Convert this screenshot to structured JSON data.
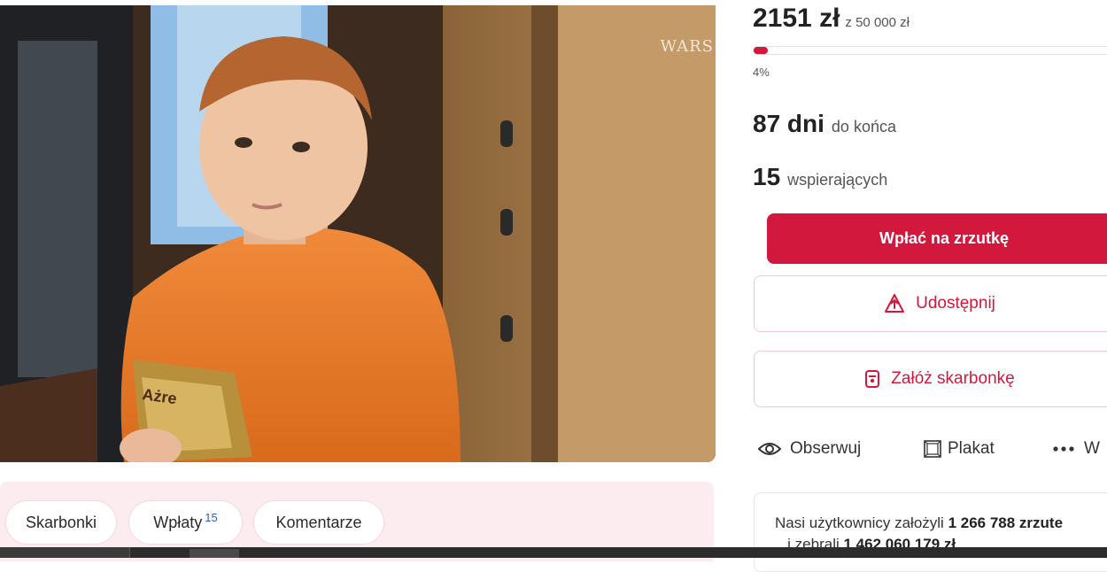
{
  "photo": {
    "watermark": "WARS",
    "package_text": "Ażre"
  },
  "fundraiser": {
    "raised": "2151 zł",
    "goal": "z 50 000 zł",
    "progress_label": "4%",
    "progress_fraction": 0.04,
    "days_num": "87 dni",
    "days_label": "do końca",
    "supporters_num": "15",
    "supporters_label": "wspierających"
  },
  "buttons": {
    "donate": "Wpłać na zrzutkę",
    "share": "Udostępnij",
    "piggybank": "Załóż skarbonkę"
  },
  "actions": {
    "watch": "Obserwuj",
    "poster": "Plakat",
    "more": "W"
  },
  "tabs": [
    {
      "label": "Skarbonki"
    },
    {
      "label": "Wpłaty",
      "count": "15"
    },
    {
      "label": "Komentarze"
    }
  ],
  "info": {
    "prefix": "Nasi użytkownicy założyli ",
    "count": "1 266 788 zrzute",
    "line2_prefix": "...i zebrali ",
    "line2_value": "1 462 060 179 zł"
  },
  "colors": {
    "accent": "#d3183d",
    "tab_panel": "#fdecef",
    "count_blue": "#2563c9"
  }
}
